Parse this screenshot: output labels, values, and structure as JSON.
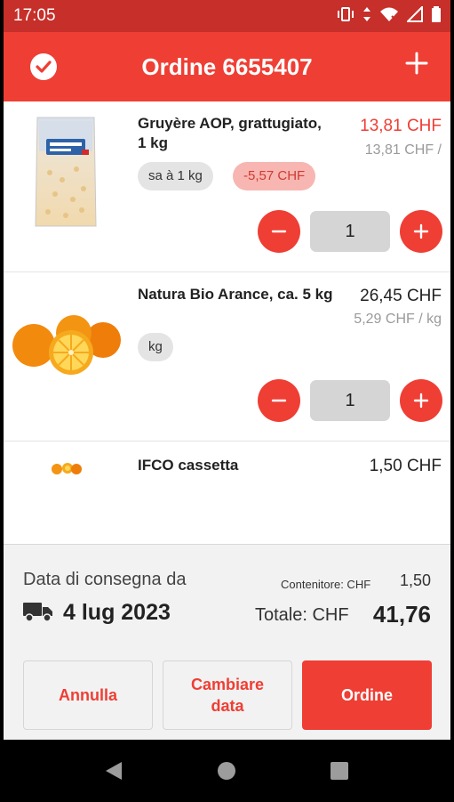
{
  "status_bar": {
    "time": "17:05"
  },
  "header": {
    "title": "Ordine 6655407"
  },
  "items": [
    {
      "name": "Gruyère AOP, grattugiato, 1 kg",
      "price": "13,81 CHF",
      "unit_price": "13,81 CHF /",
      "chips": [
        "sa à 1 kg",
        "-5,57 CHF"
      ],
      "quantity": "1",
      "price_color": "#ef3e34"
    },
    {
      "name": "Natura Bio Arance, ca. 5 kg",
      "price": "26,45 CHF",
      "unit_price": "5,29 CHF / kg",
      "chips": [
        "kg"
      ],
      "quantity": "1"
    },
    {
      "name": "IFCO cassetta",
      "price": "1,50 CHF"
    }
  ],
  "summary": {
    "delivery_label": "Data di consegna da",
    "delivery_date": "4 lug 2023",
    "container_label": "Contenitore: CHF",
    "container_value": "1,50",
    "total_label": "Totale: CHF",
    "total_value": "41,76"
  },
  "actions": {
    "cancel": "Annulla",
    "change_date": "Cambiare data",
    "order": "Ordine"
  },
  "colors": {
    "accent": "#ef3e34",
    "status_bar": "#c62f2a"
  }
}
